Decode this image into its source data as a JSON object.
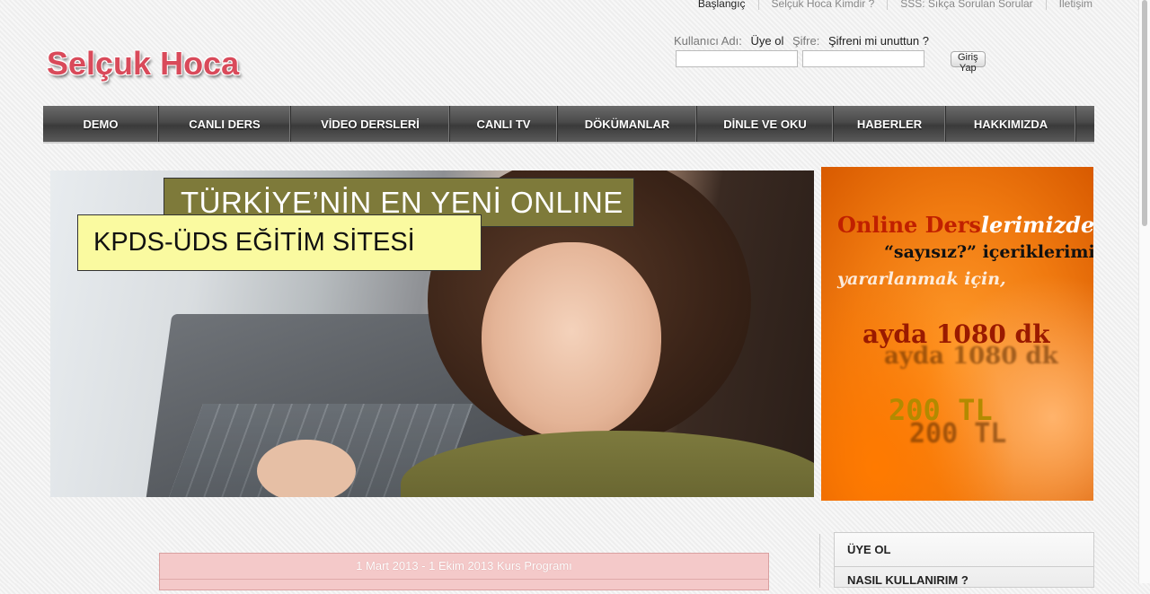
{
  "top_links": [
    "Başlangıç",
    "Selçuk Hoca Kimdir ?",
    "SSS: Sıkça Sorulan Sorular",
    "İletişim"
  ],
  "logo": "Selçuk Hoca",
  "login": {
    "username_label": "Kullanıcı Adı:",
    "register_link": "Üye ol",
    "password_label": "Şifre:",
    "forgot_link": "Şifreni mi unuttun ?",
    "username_value": "",
    "password_value": "",
    "submit_label": "Giriş Yap"
  },
  "nav": [
    "DEMO",
    "CANLI DERS",
    "VİDEO DERSLERİ",
    "CANLI TV",
    "DÖKÜMANLAR",
    "DİNLE VE OKU",
    "HABERLER",
    "HAKKIMIZDA"
  ],
  "hero": {
    "line1": "TÜRKİYE’NİN EN YENİ ONLINE",
    "line2": "KPDS-ÜDS EĞİTİM SİTESİ"
  },
  "ad": {
    "line1a": "Online Ders",
    "line1b": "lerimizden,",
    "line2": "“sayısız?” içeriklerimizden",
    "line3": "yararlanmak için,",
    "line4": "ayda 1080 dk",
    "line5": "200 TL"
  },
  "schedule": {
    "title": "1 Mart 2013 - 1 Ekim 2013 Kurs Programı"
  },
  "sidebar": [
    "ÜYE OL",
    "NASIL KULLANIRIM ?"
  ]
}
